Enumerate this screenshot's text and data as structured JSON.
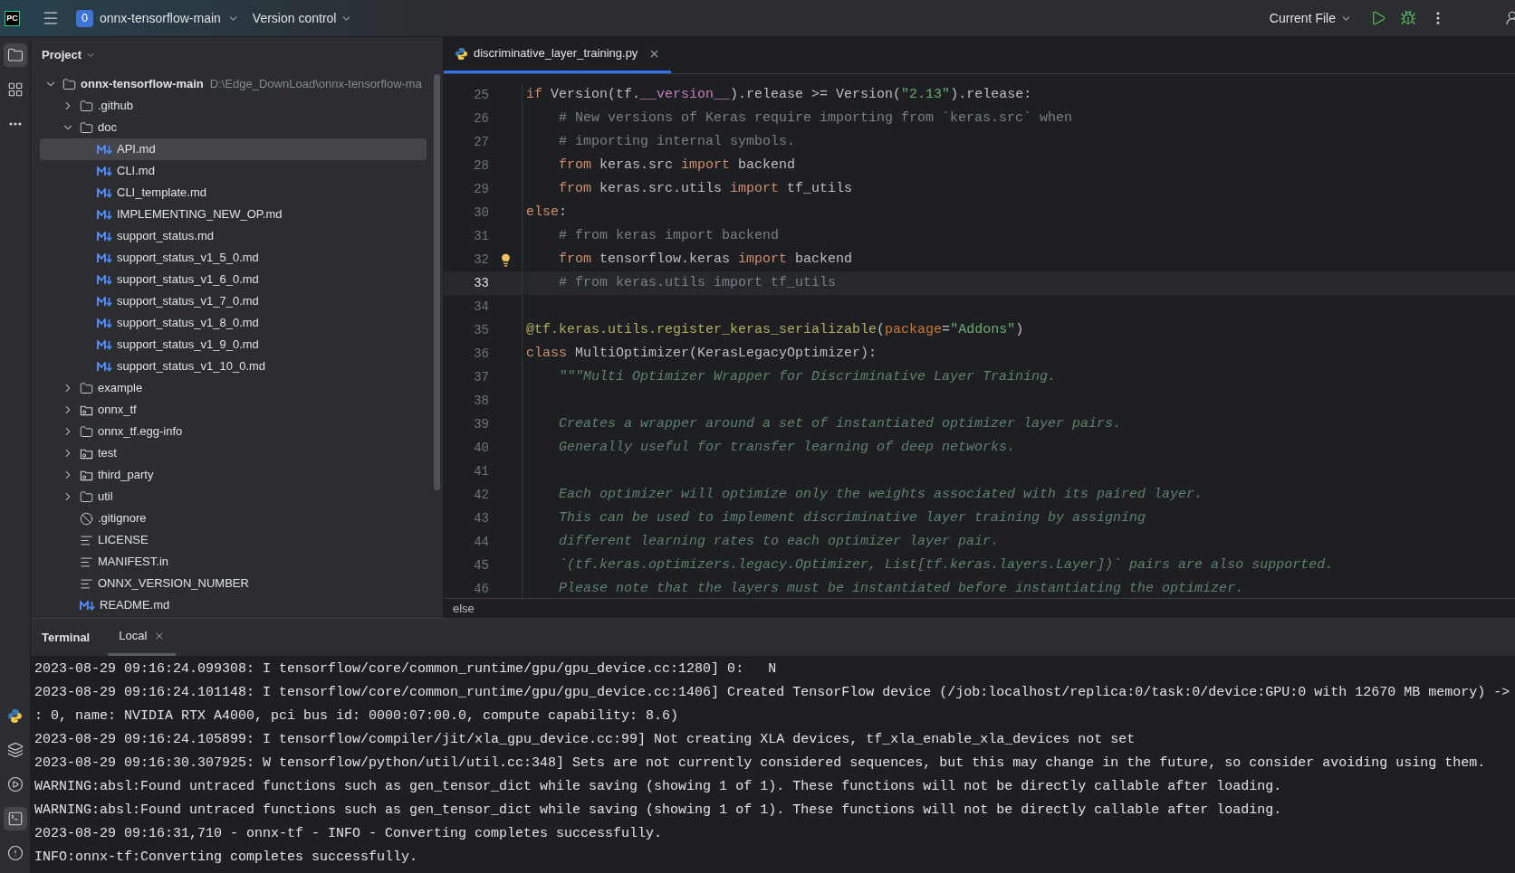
{
  "top_bar": {
    "logo": "PC",
    "project_badge": "0",
    "project_name": "onnx-tensorflow-main",
    "vcs": "Version control",
    "run_config": "Current File"
  },
  "tool_strip": {
    "top": [
      {
        "kind": "folder",
        "selected": true
      },
      {
        "kind": "structure",
        "selected": false
      },
      {
        "kind": "more",
        "selected": false
      }
    ],
    "bottom": [
      {
        "kind": "python",
        "selected": false
      },
      {
        "kind": "layers",
        "selected": false
      },
      {
        "kind": "services",
        "selected": false
      },
      {
        "kind": "terminal",
        "selected": true
      },
      {
        "kind": "problems",
        "selected": false
      }
    ]
  },
  "project": {
    "title": "Project",
    "tree": {
      "name": "onnx-tensorflow-main",
      "path": "D:\\Edge_DownLoad\\onnx-tensorflow-ma",
      "kind": "folder",
      "expanded": true,
      "selected": false,
      "children": [
        {
          "name": ".github",
          "kind": "folder",
          "expanded": false,
          "selected": false
        },
        {
          "name": "doc",
          "kind": "folder",
          "expanded": true,
          "selected": false,
          "children": [
            {
              "name": "API.md",
              "kind": "markdown",
              "selected": true
            },
            {
              "name": "CLI.md",
              "kind": "markdown",
              "selected": false
            },
            {
              "name": "CLI_template.md",
              "kind": "markdown",
              "selected": false
            },
            {
              "name": "IMPLEMENTING_NEW_OP.md",
              "kind": "markdown",
              "selected": false
            },
            {
              "name": "support_status.md",
              "kind": "markdown",
              "selected": false
            },
            {
              "name": "support_status_v1_5_0.md",
              "kind": "markdown",
              "selected": false
            },
            {
              "name": "support_status_v1_6_0.md",
              "kind": "markdown",
              "selected": false
            },
            {
              "name": "support_status_v1_7_0.md",
              "kind": "markdown",
              "selected": false
            },
            {
              "name": "support_status_v1_8_0.md",
              "kind": "markdown",
              "selected": false
            },
            {
              "name": "support_status_v1_9_0.md",
              "kind": "markdown",
              "selected": false
            },
            {
              "name": "support_status_v1_10_0.md",
              "kind": "markdown",
              "selected": false
            }
          ]
        },
        {
          "name": "example",
          "kind": "folder",
          "expanded": false,
          "selected": false
        },
        {
          "name": "onnx_tf",
          "kind": "package",
          "expanded": false,
          "selected": false
        },
        {
          "name": "onnx_tf.egg-info",
          "kind": "folder",
          "expanded": false,
          "selected": false
        },
        {
          "name": "test",
          "kind": "package",
          "expanded": false,
          "selected": false
        },
        {
          "name": "third_party",
          "kind": "package",
          "expanded": false,
          "selected": false
        },
        {
          "name": "util",
          "kind": "folder",
          "expanded": false,
          "selected": false
        },
        {
          "name": ".gitignore",
          "kind": "ignore",
          "selected": false
        },
        {
          "name": "LICENSE",
          "kind": "text",
          "selected": false
        },
        {
          "name": "MANIFEST.in",
          "kind": "text",
          "selected": false
        },
        {
          "name": "ONNX_VERSION_NUMBER",
          "kind": "text",
          "selected": false
        },
        {
          "name": "README.md",
          "kind": "markdown",
          "selected": false
        }
      ]
    }
  },
  "editor": {
    "tabs": [
      {
        "label": "discriminative_layer_training.py",
        "selected": true
      }
    ],
    "lines": [
      {
        "number": "25",
        "current": false,
        "hint": false,
        "tokens": [
          {
            "kind": "keyword",
            "text": "if"
          },
          {
            "kind": "plain",
            "text": " Version(tf."
          },
          {
            "kind": "dunder",
            "text": "__version__"
          },
          {
            "kind": "plain",
            "text": ").release >= Version("
          },
          {
            "kind": "string",
            "text": "\"2.13\""
          },
          {
            "kind": "plain",
            "text": ").release:"
          }
        ]
      },
      {
        "number": "26",
        "current": false,
        "hint": false,
        "tokens": [
          {
            "kind": "comment",
            "text": "    # New versions of Keras require importing from `keras.src` when"
          }
        ]
      },
      {
        "number": "27",
        "current": false,
        "hint": false,
        "tokens": [
          {
            "kind": "comment",
            "text": "    # importing internal symbols."
          }
        ]
      },
      {
        "number": "28",
        "current": false,
        "hint": false,
        "tokens": [
          {
            "kind": "keyword",
            "text": "    from"
          },
          {
            "kind": "plain",
            "text": " keras.src "
          },
          {
            "kind": "keyword",
            "text": "import"
          },
          {
            "kind": "plain",
            "text": " backend"
          }
        ]
      },
      {
        "number": "29",
        "current": false,
        "hint": false,
        "tokens": [
          {
            "kind": "keyword",
            "text": "    from"
          },
          {
            "kind": "plain",
            "text": " keras.src.utils "
          },
          {
            "kind": "keyword",
            "text": "import"
          },
          {
            "kind": "plain",
            "text": " tf_utils"
          }
        ]
      },
      {
        "number": "30",
        "current": false,
        "hint": false,
        "tokens": [
          {
            "kind": "keyword",
            "text": "else"
          },
          {
            "kind": "plain",
            "text": ":"
          }
        ]
      },
      {
        "number": "31",
        "current": false,
        "hint": false,
        "tokens": [
          {
            "kind": "comment",
            "text": "    # from keras import backend"
          }
        ]
      },
      {
        "number": "32",
        "current": false,
        "hint": true,
        "tokens": [
          {
            "kind": "keyword",
            "text": "    from"
          },
          {
            "kind": "plain",
            "text": " tensorflow.keras "
          },
          {
            "kind": "keyword",
            "text": "import"
          },
          {
            "kind": "plain",
            "text": " backend"
          }
        ]
      },
      {
        "number": "33",
        "current": true,
        "hint": false,
        "tokens": [
          {
            "kind": "comment",
            "text": "    # from keras.utils import tf_utils"
          }
        ]
      },
      {
        "number": "34",
        "current": false,
        "hint": false
      },
      {
        "number": "35",
        "current": false,
        "hint": false,
        "tokens": [
          {
            "kind": "decorator",
            "text": "@tf.keras.utils.register_keras_serializable"
          },
          {
            "kind": "plain",
            "text": "("
          },
          {
            "kind": "param",
            "text": "package"
          },
          {
            "kind": "plain",
            "text": "="
          },
          {
            "kind": "string",
            "text": "\"Addons\""
          },
          {
            "kind": "plain",
            "text": ")"
          }
        ]
      },
      {
        "number": "36",
        "current": false,
        "hint": false,
        "tokens": [
          {
            "kind": "keyword",
            "text": "class"
          },
          {
            "kind": "plain",
            "text": " MultiOptimizer(KerasLegacyOptimizer):"
          }
        ]
      },
      {
        "number": "37",
        "current": false,
        "hint": false,
        "tokens": [
          {
            "kind": "docstring",
            "text": "    \"\"\"Multi Optimizer Wrapper for Discriminative Layer Training."
          }
        ]
      },
      {
        "number": "38",
        "current": false,
        "hint": false
      },
      {
        "number": "39",
        "current": false,
        "hint": false,
        "tokens": [
          {
            "kind": "docstring",
            "text": "    Creates a wrapper around a set of instantiated optimizer layer pairs."
          }
        ]
      },
      {
        "number": "40",
        "current": false,
        "hint": false,
        "tokens": [
          {
            "kind": "docstring",
            "text": "    Generally useful for transfer learning of deep networks."
          }
        ]
      },
      {
        "number": "41",
        "current": false,
        "hint": false
      },
      {
        "number": "42",
        "current": false,
        "hint": false,
        "tokens": [
          {
            "kind": "docstring",
            "text": "    Each optimizer will optimize only the weights associated with its paired layer."
          }
        ]
      },
      {
        "number": "43",
        "current": false,
        "hint": false,
        "tokens": [
          {
            "kind": "docstring",
            "text": "    This can be used to implement discriminative layer training by assigning"
          }
        ]
      },
      {
        "number": "44",
        "current": false,
        "hint": false,
        "tokens": [
          {
            "kind": "docstring",
            "text": "    different learning rates to each optimizer layer pair."
          }
        ]
      },
      {
        "number": "45",
        "current": false,
        "hint": false,
        "tokens": [
          {
            "kind": "docstring",
            "text": "    `(tf.keras.optimizers.legacy.Optimizer, List[tf.keras.layers.Layer])` pairs are also supported."
          }
        ]
      },
      {
        "number": "46",
        "current": false,
        "hint": false,
        "tokens": [
          {
            "kind": "docstring",
            "text": "    Please note that the layers must be instantiated before instantiating the optimizer."
          }
        ]
      }
    ],
    "breadcrumb": "else"
  },
  "terminal": {
    "title": "Terminal",
    "tabs": [
      {
        "label": "Local",
        "selected": true
      }
    ],
    "lines": [
      "2023-08-29 09:16:24.099308: I tensorflow/core/common_runtime/gpu/gpu_device.cc:1280] 0:   N",
      "2023-08-29 09:16:24.101148: I tensorflow/core/common_runtime/gpu/gpu_device.cc:1406] Created TensorFlow device (/job:localhost/replica:0/task:0/device:GPU:0 with 12670 MB memory) ->",
      ": 0, name: NVIDIA RTX A4000, pci bus id: 0000:07:00.0, compute capability: 8.6)",
      "2023-08-29 09:16:24.105899: I tensorflow/compiler/jit/xla_gpu_device.cc:99] Not creating XLA devices, tf_xla_enable_xla_devices not set",
      "2023-08-29 09:16:30.307925: W tensorflow/python/util/util.cc:348] Sets are not currently considered sequences, but this may change in the future, so consider avoiding using them.",
      "WARNING:absl:Found untraced functions such as gen_tensor_dict while saving (showing 1 of 1). These functions will not be directly callable after loading.",
      "WARNING:absl:Found untraced functions such as gen_tensor_dict while saving (showing 1 of 1). These functions will not be directly callable after loading.",
      "2023-08-29 09:16:31,710 - onnx-tf - INFO - Converting completes successfully.",
      "INFO:onnx-tf:Converting completes successfully."
    ]
  }
}
